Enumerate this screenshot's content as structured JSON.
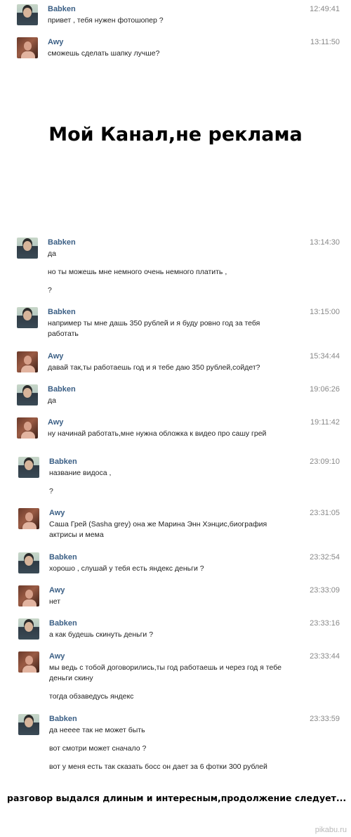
{
  "banner": "Мой Канал,не реклама",
  "footer": "разговор выдался длиным и интересным,продолжение следует...",
  "watermark": "pikabu.ru",
  "messages": [
    {
      "author": "Babken",
      "time": "12:49:41",
      "lines": [
        "привет , тебя нужен фотошопер ?"
      ]
    },
    {
      "author": "Awy",
      "time": "13:11:50",
      "lines": [
        "сможешь сделать шапку лучше?"
      ]
    },
    {
      "author": "Babken",
      "time": "13:14:30",
      "lines": [
        "да",
        "но ты можешь мне немного очень немного платить ,",
        "?"
      ]
    },
    {
      "author": "Babken",
      "time": "13:15:00",
      "lines": [
        "например ты мне дашь 350 рублей и я буду ровно год за тебя",
        "работать"
      ]
    },
    {
      "author": "Awy",
      "time": "15:34:44",
      "lines": [
        "давай так,ты работаешь год и я тебе даю 350 рублей,сойдет?"
      ]
    },
    {
      "author": "Babken",
      "time": "19:06:26",
      "lines": [
        "да"
      ]
    },
    {
      "author": "Awy",
      "time": "19:11:42",
      "lines": [
        "ну начинай работать,мне нужна обложка к видео про сашу грей"
      ]
    },
    {
      "author": "Babken",
      "time": "23:09:10",
      "lines": [
        "название видоса ,",
        "?"
      ]
    },
    {
      "author": "Awy",
      "time": "23:31:05",
      "lines": [
        "Саша Грей (Sasha grey) она же Марина Энн Хэнцис,биография",
        "актрисы и мема"
      ]
    },
    {
      "author": "Babken",
      "time": "23:32:54",
      "lines": [
        "хорошо , слушай у тебя есть яндекс деньги ?"
      ]
    },
    {
      "author": "Awy",
      "time": "23:33:09",
      "lines": [
        "нет"
      ]
    },
    {
      "author": "Babken",
      "time": "23:33:16",
      "lines": [
        "а как будешь скинуть деньги ?"
      ]
    },
    {
      "author": "Awy",
      "time": "23:33:44",
      "lines": [
        "мы ведь с тобой договорились,ты год работаешь и через год я тебе",
        "деньги скину",
        "тогда обзаведусь яндекс"
      ]
    },
    {
      "author": "Babken",
      "time": "23:33:59",
      "lines": [
        "да нееее так не может быть",
        "вот смотри может сначало ?",
        "вот у меня есть так сказать босс он дает за 6 фотки 300 рублей"
      ]
    }
  ]
}
